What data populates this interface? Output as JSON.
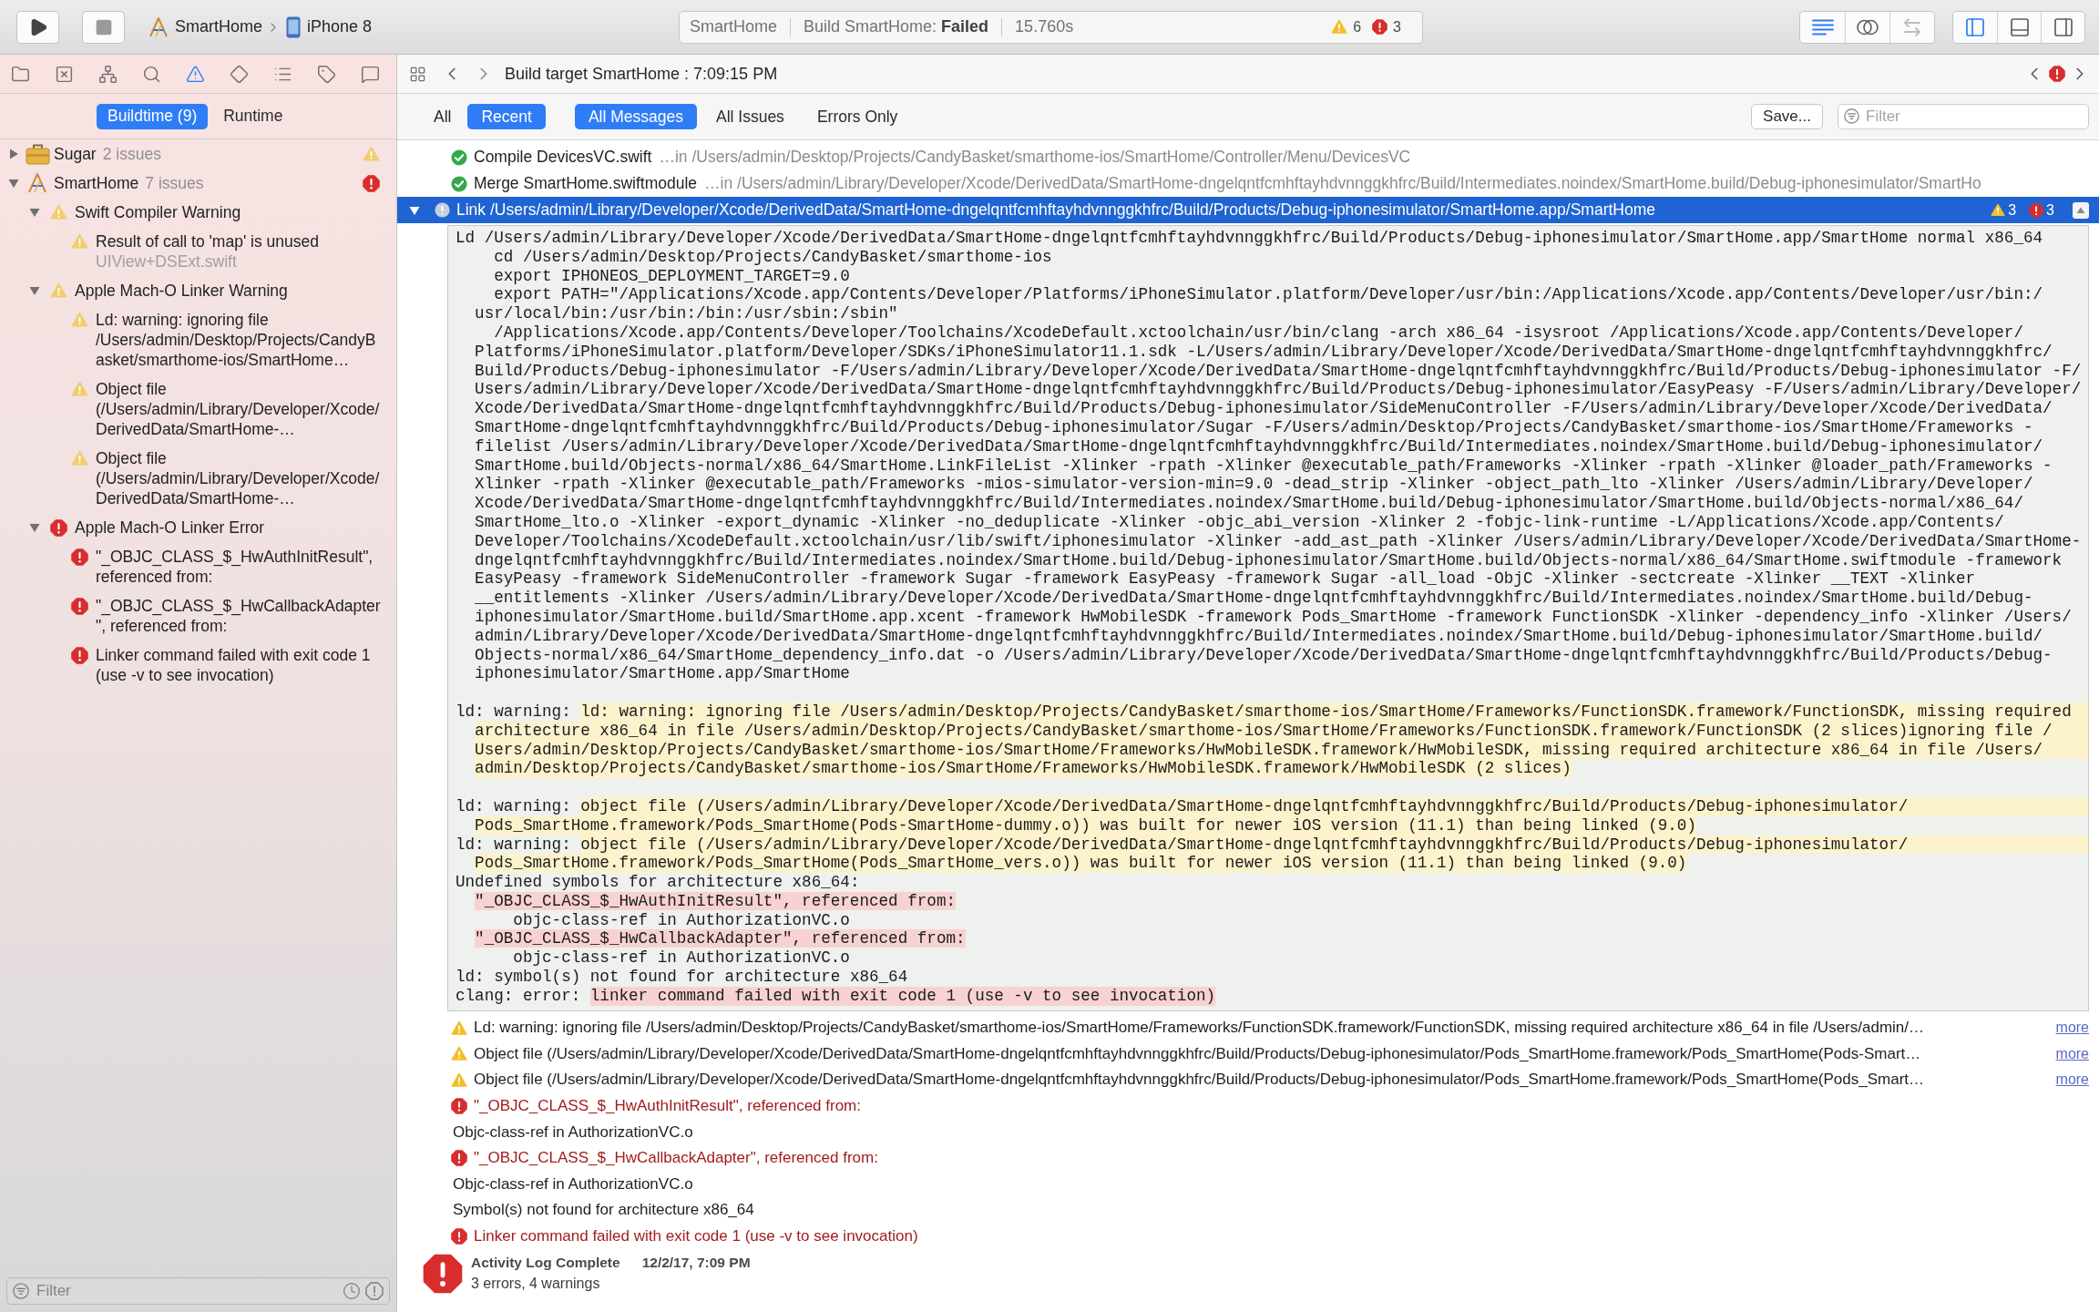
{
  "toolbar": {
    "run_controls": [
      {
        "kind": "run",
        "disabled": false
      },
      {
        "kind": "stop",
        "disabled": true
      }
    ],
    "scheme": {
      "target": "SmartHome",
      "device": "iPhone 8"
    },
    "activity": {
      "project": "SmartHome",
      "status": "Build SmartHome: **Failed**",
      "duration": "15.760s",
      "warnings": "6",
      "errors": "3"
    },
    "editor_modes": [
      {
        "kind": "standard",
        "selected": true,
        "disabled": false
      },
      {
        "kind": "assistant",
        "selected": false,
        "disabled": false
      },
      {
        "kind": "version",
        "selected": false,
        "disabled": true
      }
    ],
    "panels": [
      {
        "kind": "navigator",
        "on": true
      },
      {
        "kind": "debug",
        "on": false
      },
      {
        "kind": "utilities",
        "on": false
      }
    ]
  },
  "navigator": {
    "tabs": [
      {
        "kind": "project",
        "selected": false
      },
      {
        "kind": "source_control",
        "selected": false
      },
      {
        "kind": "symbol",
        "selected": false
      },
      {
        "kind": "find",
        "selected": false
      },
      {
        "kind": "issue",
        "selected": true
      },
      {
        "kind": "test",
        "selected": false
      },
      {
        "kind": "debug",
        "selected": false
      },
      {
        "kind": "breakpoint",
        "selected": false
      },
      {
        "kind": "report",
        "selected": false
      }
    ],
    "scopes": [
      {
        "label": "Buildtime (9)",
        "selected": true
      },
      {
        "label": "Runtime",
        "selected": false
      }
    ],
    "tree": [
      {
        "kind": "framework",
        "title": "Sugar",
        "count": "2 issues",
        "severity": {
          "kind": "warning"
        },
        "expanded": false
      },
      {
        "kind": "app",
        "title": "SmartHome",
        "count": "7 issues",
        "severity": {
          "kind": "error"
        },
        "expanded": true,
        "children": [
          {
            "kind": "group",
            "title": "Swift Compiler Warning",
            "severity": {
              "kind": "warning"
            },
            "expanded": true,
            "children": [
              {
                "kind": "issue",
                "title": "Result of call to 'map' is unused",
                "detail": "UIView+DSExt.swift",
                "severity": {
                  "kind": "warning"
                }
              }
            ]
          },
          {
            "kind": "group",
            "title": "Apple Mach-O Linker Warning",
            "severity": {
              "kind": "warning"
            },
            "expanded": true,
            "children": [
              {
                "kind": "issue",
                "title": "Ld: warning: ignoring file /Users/admin/Desktop/Projects/CandyBasket/smarthome-ios/SmartHome…",
                "severity": {
                  "kind": "warning"
                }
              },
              {
                "kind": "issue",
                "title": "Object file (/Users/admin/Library/Developer/Xcode/DerivedData/SmartHome-…",
                "severity": {
                  "kind": "warning"
                }
              },
              {
                "kind": "issue",
                "title": "Object file (/Users/admin/Library/Developer/Xcode/DerivedData/SmartHome-…",
                "severity": {
                  "kind": "warning"
                }
              }
            ]
          },
          {
            "kind": "group",
            "title": "Apple Mach-O Linker Error",
            "severity": {
              "kind": "error"
            },
            "expanded": true,
            "children": [
              {
                "kind": "issue",
                "title": "\"_OBJC_CLASS_$_HwAuthInitResult\", referenced from:",
                "severity": {
                  "kind": "error"
                }
              },
              {
                "kind": "issue",
                "title": "\"_OBJC_CLASS_$_HwCallbackAdapter\", referenced from:",
                "severity": {
                  "kind": "error"
                }
              },
              {
                "kind": "issue",
                "title": "Linker command failed with exit code 1 (use -v to see invocation)",
                "severity": {
                  "kind": "error"
                }
              }
            ]
          }
        ]
      }
    ],
    "filter": {
      "placeholder": "Filter"
    }
  },
  "log": {
    "jump_bar": {
      "title": "Build target SmartHome : 7:09:15 PM"
    },
    "scopes": [
      {
        "label": "All",
        "selected": false
      },
      {
        "label": "Recent",
        "selected": true
      }
    ],
    "types": [
      {
        "label": "All Messages",
        "selected": true
      },
      {
        "label": "All Issues",
        "selected": false
      },
      {
        "label": "Errors Only",
        "selected": false
      }
    ],
    "save_button": "Save...",
    "search": {
      "placeholder": "Filter"
    },
    "steps": [
      {
        "kind": "success",
        "title": "Compile DevicesVC.swift",
        "location": "…in /Users/admin/Desktop/Projects/CandyBasket/smarthome-ios/SmartHome/Controller/Menu/DevicesVC",
        "selected": false
      },
      {
        "kind": "success",
        "title": "Merge SmartHome.swiftmodule",
        "location": "…in /Users/admin/Library/Developer/Xcode/DerivedData/SmartHome-dngelqntfcmhftayhdvnnggkhfrc/Build/Intermediates.noindex/SmartHome.build/Debug-iphonesimulator/SmartHo",
        "selected": false
      },
      {
        "kind": "failed",
        "title": "Link /Users/admin/Library/Developer/Xcode/DerivedData/SmartHome-dngelqntfcmhftayhdvnnggkhfrc/Build/Products/Debug-iphonesimulator/SmartHome.app/SmartHome",
        "selected": true,
        "expanded": true,
        "warnings": "3",
        "errors": "3"
      }
    ],
    "transcript": {
      "command": {
        "lines": [
          "Ld /Users/admin/Library/Developer/Xcode/DerivedData/SmartHome-dngelqntfcmhftayhdvnnggkhfrc/Build/Products/Debug-iphonesimulator/SmartHome.app/SmartHome normal x86_64"
        ],
        "steps": [
          {
            "lines": [
              "cd /Users/admin/Desktop/Projects/CandyBasket/smarthome-ios"
            ]
          },
          {
            "lines": [
              "export IPHONEOS_DEPLOYMENT_TARGET=9.0"
            ]
          },
          {
            "lines": [
              "export PATH=\"/Applications/Xcode.app/Contents/Developer/Platforms/iPhoneSimulator.platform/Developer/usr/bin:/Applications/Xcode.app/Contents/Developer/usr/bin:/",
              "usr/local/bin:/usr/bin:/bin:/usr/sbin:/sbin\""
            ]
          },
          {
            "lines": [
              "/Applications/Xcode.app/Contents/Developer/Toolchains/XcodeDefault.xctoolchain/usr/bin/clang -arch x86_64 -isysroot /Applications/Xcode.app/Contents/Developer/",
              "Platforms/iPhoneSimulator.platform/Developer/SDKs/iPhoneSimulator11.1.sdk -L/Users/admin/Library/Developer/Xcode/DerivedData/SmartHome-dngelqntfcmhftayhdvnnggkhfrc/",
              "Build/Products/Debug-iphonesimulator -F/Users/admin/Library/Developer/Xcode/DerivedData/SmartHome-dngelqntfcmhftayhdvnnggkhfrc/Build/Products/Debug-iphonesimulator -F/",
              "Users/admin/Library/Developer/Xcode/DerivedData/SmartHome-dngelqntfcmhftayhdvnnggkhfrc/Build/Products/Debug-iphonesimulator/EasyPeasy -F/Users/admin/Library/Developer/",
              "Xcode/DerivedData/SmartHome-dngelqntfcmhftayhdvnnggkhfrc/Build/Products/Debug-iphonesimulator/SideMenuController -F/Users/admin/Library/Developer/Xcode/DerivedData/",
              "SmartHome-dngelqntfcmhftayhdvnnggkhfrc/Build/Products/Debug-iphonesimulator/Sugar -F/Users/admin/Desktop/Projects/CandyBasket/smarthome-ios/SmartHome/Frameworks -",
              "filelist /Users/admin/Library/Developer/Xcode/DerivedData/SmartHome-dngelqntfcmhftayhdvnnggkhfrc/Build/Intermediates.noindex/SmartHome.build/Debug-iphonesimulator/",
              "SmartHome.build/Objects-normal/x86_64/SmartHome.LinkFileList -Xlinker -rpath -Xlinker @executable_path/Frameworks -Xlinker -rpath -Xlinker @loader_path/Frameworks -",
              "Xlinker -rpath -Xlinker @executable_path/Frameworks -mios-simulator-version-min=9.0 -dead_strip -Xlinker -object_path_lto -Xlinker /Users/admin/Library/Developer/",
              "Xcode/DerivedData/SmartHome-dngelqntfcmhftayhdvnnggkhfrc/Build/Intermediates.noindex/SmartHome.build/Debug-iphonesimulator/SmartHome.build/Objects-normal/x86_64/",
              "SmartHome_lto.o -Xlinker -export_dynamic -Xlinker -no_deduplicate -Xlinker -objc_abi_version -Xlinker 2 -fobjc-link-runtime -L/Applications/Xcode.app/Contents/",
              "Developer/Toolchains/XcodeDefault.xctoolchain/usr/lib/swift/iphonesimulator -Xlinker -add_ast_path -Xlinker /Users/admin/Library/Developer/Xcode/DerivedData/SmartHome-",
              "dngelqntfcmhftayhdvnnggkhfrc/Build/Intermediates.noindex/SmartHome.build/Debug-iphonesimulator/SmartHome.build/Objects-normal/x86_64/SmartHome.swiftmodule -framework",
              "EasyPeasy -framework SideMenuController -framework Sugar -framework EasyPeasy -framework Sugar -all_load -ObjC -Xlinker -sectcreate -Xlinker __TEXT -Xlinker",
              "__entitlements -Xlinker /Users/admin/Library/Developer/Xcode/DerivedData/SmartHome-dngelqntfcmhftayhdvnnggkhfrc/Build/Intermediates.noindex/SmartHome.build/Debug-",
              "iphonesimulator/SmartHome.build/SmartHome.app.xcent -framework HwMobileSDK -framework Pods_SmartHome -framework FunctionSDK -Xlinker -dependency_info -Xlinker /Users/",
              "admin/Library/Developer/Xcode/DerivedData/SmartHome-dngelqntfcmhftayhdvnnggkhfrc/Build/Intermediates.noindex/SmartHome.build/Debug-iphonesimulator/SmartHome.build/",
              "Objects-normal/x86_64/SmartHome_dependency_info.dat -o /Users/admin/Library/Developer/Xcode/DerivedData/SmartHome-dngelqntfcmhftayhdvnnggkhfrc/Build/Products/Debug-",
              "iphonesimulator/SmartHome.app/SmartHome"
            ]
          }
        ]
      },
      "sections": [
        [
          {
            "kind": "warning",
            "prefix": "ld: warning:",
            "lines": [
              "ld: warning: ignoring file /Users/admin/Desktop/Projects/CandyBasket/smarthome-ios/SmartHome/Frameworks/FunctionSDK.framework/FunctionSDK, missing required",
              "architecture x86_64 in file /Users/admin/Desktop/Projects/CandyBasket/smarthome-ios/SmartHome/Frameworks/FunctionSDK.framework/FunctionSDK (2 slices)ignoring file /",
              "Users/admin/Desktop/Projects/CandyBasket/smarthome-ios/SmartHome/Frameworks/HwMobileSDK.framework/HwMobileSDK, missing required architecture x86_64 in file /Users/",
              "admin/Desktop/Projects/CandyBasket/smarthome-ios/SmartHome/Frameworks/HwMobileSDK.framework/HwMobileSDK (2 slices)"
            ]
          }
        ],
        [
          {
            "kind": "warning",
            "prefix": "ld: warning:",
            "lines": [
              "object file (/Users/admin/Library/Developer/Xcode/DerivedData/SmartHome-dngelqntfcmhftayhdvnnggkhfrc/Build/Products/Debug-iphonesimulator/",
              "Pods_SmartHome.framework/Pods_SmartHome(Pods-SmartHome-dummy.o)) was built for newer iOS version (11.1) than being linked (9.0)"
            ]
          },
          {
            "kind": "warning",
            "prefix": "ld: warning:",
            "lines": [
              "object file (/Users/admin/Library/Developer/Xcode/DerivedData/SmartHome-dngelqntfcmhftayhdvnnggkhfrc/Build/Products/Debug-iphonesimulator/",
              "Pods_SmartHome.framework/Pods_SmartHome(Pods_SmartHome_vers.o)) was built for newer iOS version (11.1) than being linked (9.0)"
            ]
          },
          {
            "kind": "plain",
            "lines": [
              "Undefined symbols for architecture x86_64:"
            ]
          },
          {
            "kind": "symbol",
            "lines": [
              "\"_OBJC_CLASS_$_HwAuthInitResult\", referenced from:"
            ]
          },
          {
            "kind": "reference",
            "lines": [
              "objc-class-ref in AuthorizationVC.o"
            ]
          },
          {
            "kind": "symbol",
            "lines": [
              "\"_OBJC_CLASS_$_HwCallbackAdapter\", referenced from:"
            ]
          },
          {
            "kind": "reference",
            "lines": [
              "objc-class-ref in AuthorizationVC.o"
            ]
          },
          {
            "kind": "plain",
            "lines": [
              "ld: symbol(s) not found for architecture x86_64"
            ]
          },
          {
            "kind": "error",
            "prefix": "clang: error:",
            "lines": [
              "linker command failed with exit code 1 (use -v to see invocation)"
            ]
          }
        ]
      ]
    },
    "messages": [
      {
        "kind": "warning",
        "text": "Ld: warning: ignoring file /Users/admin/Desktop/Projects/CandyBasket/smarthome-ios/SmartHome/Frameworks/FunctionSDK.framework/FunctionSDK, missing required architecture x86_64 in file /Users/admin/…",
        "more": "more"
      },
      {
        "kind": "warning",
        "text": "Object file (/Users/admin/Library/Developer/Xcode/DerivedData/SmartHome-dngelqntfcmhftayhdvnnggkhfrc/Build/Products/Debug-iphonesimulator/Pods_SmartHome.framework/Pods_SmartHome(Pods-Smart…",
        "more": "more"
      },
      {
        "kind": "warning",
        "text": "Object file (/Users/admin/Library/Developer/Xcode/DerivedData/SmartHome-dngelqntfcmhftayhdvnnggkhfrc/Build/Products/Debug-iphonesimulator/Pods_SmartHome.framework/Pods_SmartHome(Pods_Smart…",
        "more": "more"
      },
      {
        "kind": "error",
        "text": "\"_OBJC_CLASS_$_HwAuthInitResult\", referenced from:"
      },
      {
        "kind": "note",
        "text": "Objc-class-ref in AuthorizationVC.o"
      },
      {
        "kind": "error",
        "text": "\"_OBJC_CLASS_$_HwCallbackAdapter\", referenced from:"
      },
      {
        "kind": "note",
        "text": "Objc-class-ref in AuthorizationVC.o"
      },
      {
        "kind": "note",
        "text": "Symbol(s) not found for architecture x86_64"
      },
      {
        "kind": "error",
        "text": "Linker command failed with exit code 1 (use -v to see invocation)"
      }
    ],
    "summary": {
      "title": "Activity Log Complete",
      "time": "12/2/17, 7:09 PM",
      "counts": "3 errors, 4 warnings"
    }
  }
}
